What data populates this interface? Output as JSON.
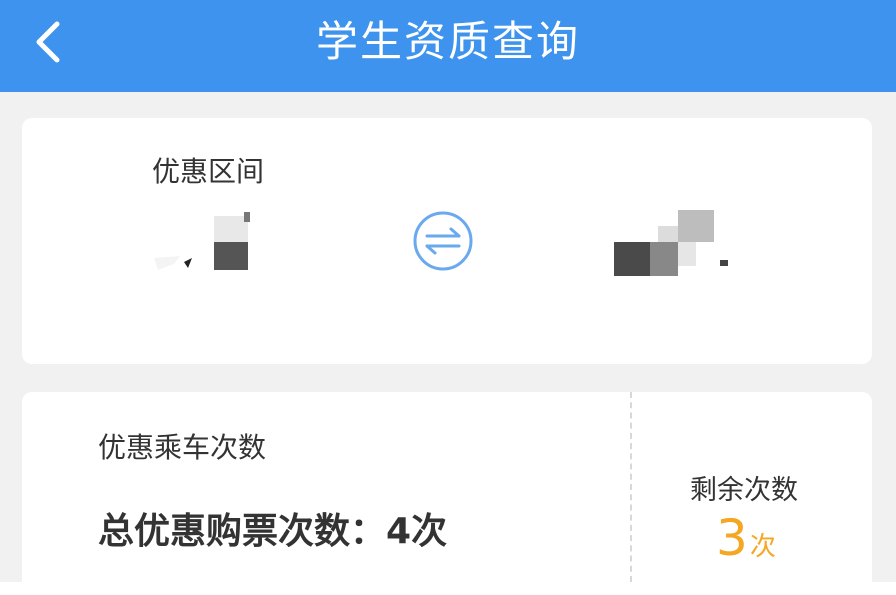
{
  "header": {
    "title": "学生资质查询",
    "back_icon": "chevron-left-icon",
    "color": "#3d93ee"
  },
  "discount_section": {
    "label": "优惠区间",
    "swap_icon": "swap-arrows-icon"
  },
  "rides_section": {
    "label": "优惠乘车次数",
    "total_label": "总优惠购票次数：",
    "total_value": "4次",
    "remaining_label": "剩余次数",
    "remaining_value": "3",
    "remaining_unit": "次",
    "accent_color": "#f5a623"
  }
}
